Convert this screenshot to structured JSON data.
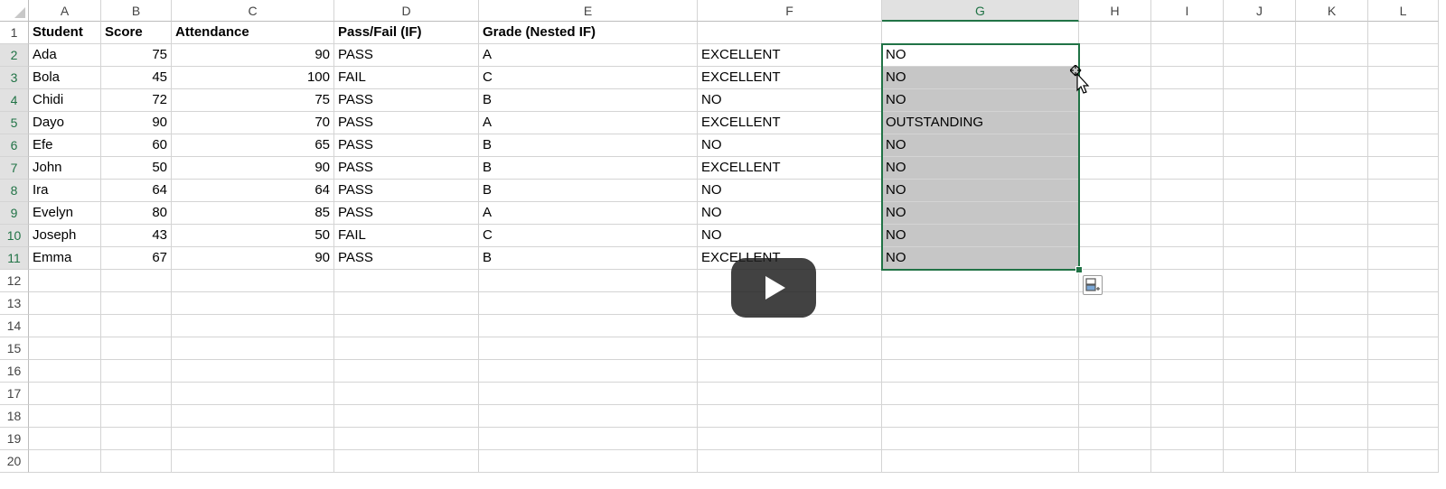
{
  "sheet": {
    "columns": [
      "A",
      "B",
      "C",
      "D",
      "E",
      "F",
      "G",
      "H",
      "I",
      "J",
      "K",
      "L"
    ],
    "selected_column": "G",
    "row_numbers": [
      "1",
      "2",
      "3",
      "4",
      "5",
      "6",
      "7",
      "8",
      "9",
      "10",
      "11",
      "12",
      "13",
      "14",
      "15",
      "16",
      "17",
      "18",
      "19",
      "20"
    ],
    "headers": [
      "Student",
      "Score",
      "Attendance",
      "Pass/Fail (IF)",
      "Grade (Nested IF)",
      "",
      ""
    ],
    "rows": [
      [
        "Ada",
        "75",
        "90",
        "PASS",
        "A",
        "EXCELLENT",
        "NO"
      ],
      [
        "Bola",
        "45",
        "100",
        "FAIL",
        "C",
        "EXCELLENT",
        "NO"
      ],
      [
        "Chidi",
        "72",
        "75",
        "PASS",
        "B",
        "NO",
        "NO"
      ],
      [
        "Dayo",
        "90",
        "70",
        "PASS",
        "A",
        "EXCELLENT",
        "OUTSTANDING"
      ],
      [
        "Efe",
        "60",
        "65",
        "PASS",
        "B",
        "NO",
        "NO"
      ],
      [
        "John",
        "50",
        "90",
        "PASS",
        "B",
        "EXCELLENT",
        "NO"
      ],
      [
        "Ira",
        "64",
        "64",
        "PASS",
        "B",
        "NO",
        "NO"
      ],
      [
        "Evelyn",
        "80",
        "85",
        "PASS",
        "A",
        "NO",
        "NO"
      ],
      [
        "Joseph",
        "43",
        "50",
        "FAIL",
        "C",
        "NO",
        "NO"
      ],
      [
        "Emma",
        "67",
        "90",
        "PASS",
        "B",
        "EXCELLENT",
        "NO"
      ]
    ]
  },
  "colors": {
    "accent": "#217346",
    "selection_fill": "#c6c6c6",
    "gridline": "#d4d4d4"
  },
  "icons": {
    "play": "play-icon",
    "cursor": "move-cursor-icon",
    "quick_analysis": "quick-analysis-icon"
  }
}
